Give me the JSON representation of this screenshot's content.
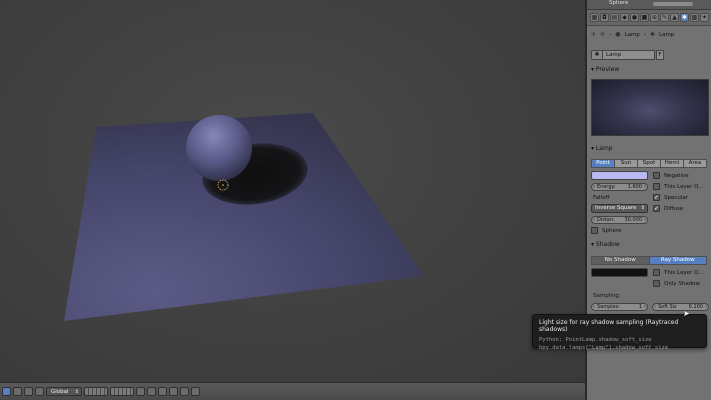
{
  "topbar": {
    "object_name": "Sphere"
  },
  "context_tabs": [
    "render",
    "layers",
    "scene",
    "world",
    "object",
    "constraints",
    "modifiers",
    "data",
    "material",
    "texture",
    "lamp",
    "physics"
  ],
  "breadcrumb": {
    "item1": "Lamp",
    "item2": "Lamp"
  },
  "datablock": {
    "name": "Lamp",
    "fake_user": "F"
  },
  "preview": {
    "header": "Preview"
  },
  "lamp": {
    "header": "Lamp",
    "types": [
      "Point",
      "Sun",
      "Spot",
      "Hemi",
      "Area"
    ],
    "selected_type": "Point",
    "color": "#b8b8f2",
    "energy_label": "Energy:",
    "energy_value": "1.600",
    "falloff_label": "Falloff",
    "falloff_value": "Inverse Square",
    "distance_label": "Distan:",
    "distance_value": "30.000",
    "negative_label": "Negative",
    "this_layer_label": "This Layer O...",
    "specular_label": "Specular",
    "diffuse_label": "Diffuse",
    "sphere_label": "Sphere"
  },
  "shadow": {
    "header": "Shadow",
    "no_shadow_label": "No Shadow",
    "ray_shadow_label": "Ray Shadow",
    "color": "#111111",
    "this_layer_label": "This Layer O...",
    "only_shadow_label": "Only Shadow",
    "sampling_label": "Sampling:",
    "samples_label": "Samples:",
    "samples_value": "1",
    "soft_size_label": "Soft Siz",
    "soft_size_value": "0.100"
  },
  "tooltip": {
    "title": "Light size for ray shadow sampling (Raytraced shadows)",
    "python1": "Python: PointLamp.shadow_soft_size",
    "python2": "bpy.data.lamps[\"Lamp\"].shadow_soft_size"
  },
  "view_header": {
    "orientation": "Global"
  }
}
